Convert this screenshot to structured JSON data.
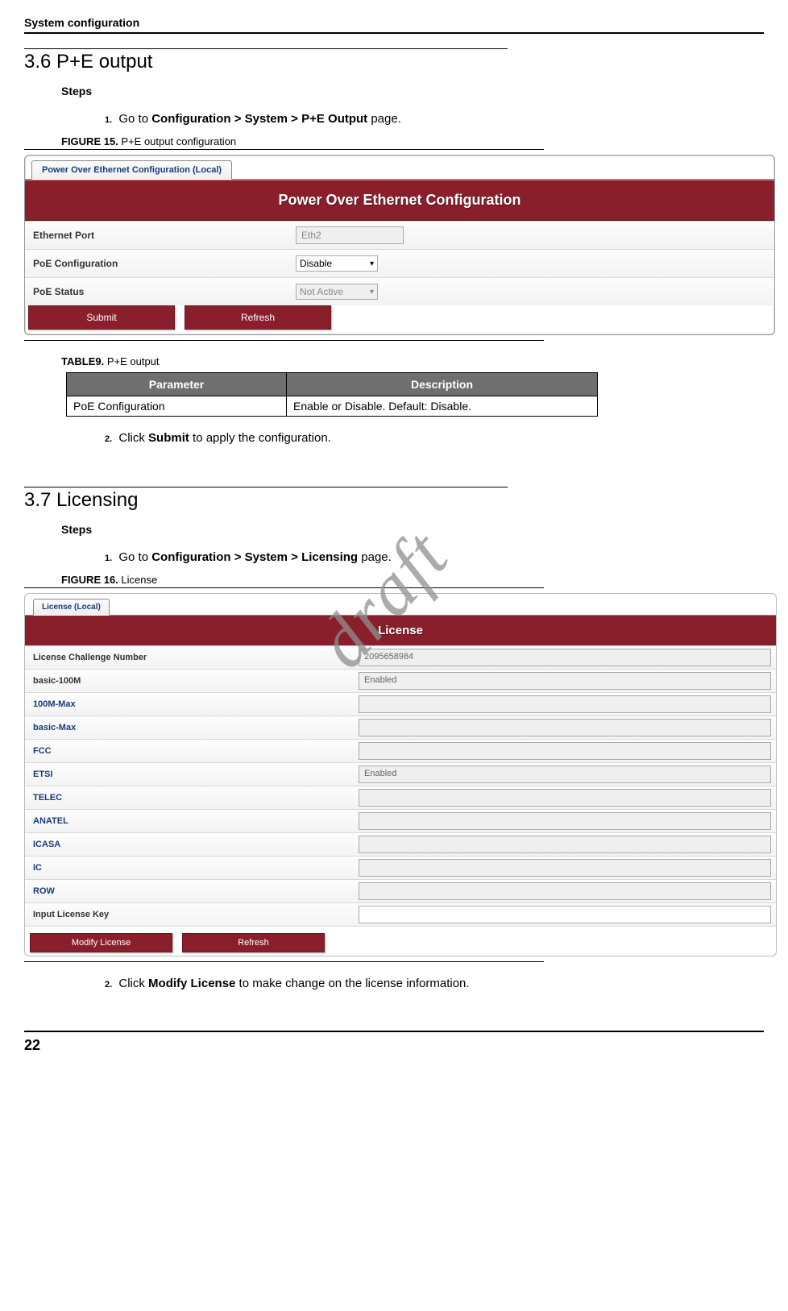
{
  "header": {
    "running": "System configuration"
  },
  "section36": {
    "title": "3.6 P+E output",
    "steps_label": "Steps",
    "step1_num": "1.",
    "step1_pre": "Go to ",
    "step1_bold": "Configuration > System > P+E Output",
    "step1_post": " page."
  },
  "fig15": {
    "caption_prefix": "FIGURE 15.",
    "caption_text": " P+E output configuration",
    "tab": "Power Over Ethernet Configuration (Local)",
    "title": "Power Over Ethernet Configuration",
    "rows": {
      "eth_label": "Ethernet Port",
      "eth_value": "Eth2",
      "cfg_label": "PoE Configuration",
      "cfg_value": "Disable",
      "status_label": "PoE Status",
      "status_value": "Not Active"
    },
    "buttons": {
      "submit": "Submit",
      "refresh": "Refresh"
    }
  },
  "table9": {
    "caption_prefix": "TABLE9.",
    "caption_text": " P+E output",
    "headers": {
      "param": "Parameter",
      "desc": "Description"
    },
    "rows": [
      {
        "param": "PoE Configuration",
        "desc": "Enable or Disable. Default: Disable."
      }
    ]
  },
  "section36b": {
    "step2_num": "2.",
    "step2_pre": "Click ",
    "step2_bold": "Submit",
    "step2_post": " to apply the configuration."
  },
  "section37": {
    "title": "3.7 Licensing",
    "steps_label": "Steps",
    "step1_num": "1.",
    "step1_pre": "Go to ",
    "step1_bold": "Configuration > System > Licensing",
    "step1_post": " page."
  },
  "fig16": {
    "caption_prefix": "FIGURE 16.",
    "caption_text": " License",
    "tab": "License (Local)",
    "title": "License",
    "rows": [
      {
        "label": "License Challenge Number",
        "value": "2095658984",
        "plain": true
      },
      {
        "label": "basic-100M",
        "value": "Enabled",
        "plain": true
      },
      {
        "label": "100M-Max",
        "value": ""
      },
      {
        "label": "basic-Max",
        "value": ""
      },
      {
        "label": "FCC",
        "value": ""
      },
      {
        "label": "ETSI",
        "value": "Enabled"
      },
      {
        "label": "TELEC",
        "value": ""
      },
      {
        "label": "ANATEL",
        "value": ""
      },
      {
        "label": "ICASA",
        "value": ""
      },
      {
        "label": "IC",
        "value": ""
      },
      {
        "label": "ROW",
        "value": ""
      },
      {
        "label": "Input License Key",
        "value": "",
        "plain": true,
        "editable": true
      }
    ],
    "buttons": {
      "modify": "Modify License",
      "refresh": "Refresh"
    }
  },
  "section37b": {
    "step2_num": "2.",
    "step2_pre": "Click ",
    "step2_bold": "Modify License",
    "step2_post": " to make change on the license information."
  },
  "watermark": "draft",
  "page_number": "22"
}
